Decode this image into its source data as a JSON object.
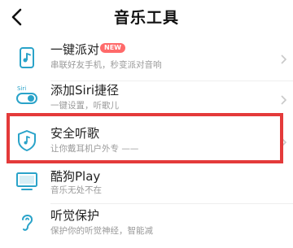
{
  "header": {
    "title": "音乐工具"
  },
  "items": [
    {
      "label": "一键派对",
      "badge": "NEW",
      "sub": "串联好友手机，秒变派对音响"
    },
    {
      "label": "添加Siri捷径",
      "sub": "一键设置，听歌儿"
    },
    {
      "label": "安全听歌",
      "sub": "让你戴耳机户外专 ——"
    },
    {
      "label": "酷狗Play",
      "sub": "音乐无处不在"
    },
    {
      "label": "听觉保护",
      "sub": "保护你的听觉神经，智能减"
    }
  ],
  "icons": {
    "back": "chevron-left-icon",
    "party": "phone-music-icon",
    "siri": "siri-toggle-icon",
    "safe": "shield-music-icon",
    "play": "monitor-icon",
    "hearing": "ear-icon"
  },
  "colors": {
    "highlight": "#e43a3a",
    "accent": "#2aa3c9",
    "badge": "#ff6a6a"
  }
}
